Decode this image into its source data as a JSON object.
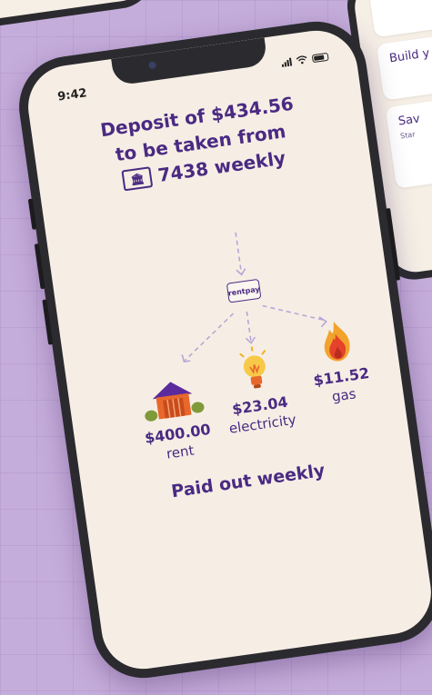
{
  "background_cards": [
    {
      "title": "Build y"
    },
    {
      "title": "Sav",
      "subtitle": "Star"
    }
  ],
  "status_bar": {
    "time": "9:42"
  },
  "deposit": {
    "line1": "Deposit of $434.56",
    "line2": "to be taken from",
    "account_last4": "7438",
    "frequency": "weekly"
  },
  "logo": {
    "text": "rentpay"
  },
  "payees": [
    {
      "amount": "$400.00",
      "label": "rent",
      "icon": "house-icon"
    },
    {
      "amount": "$23.04",
      "label": "electricity",
      "icon": "lightbulb-icon"
    },
    {
      "amount": "$11.52",
      "label": "gas",
      "icon": "flame-icon"
    }
  ],
  "footer": {
    "text": "Paid out weekly"
  },
  "colors": {
    "accent": "#4a2a82",
    "screen": "#f6eee5",
    "background": "#c5addb"
  }
}
